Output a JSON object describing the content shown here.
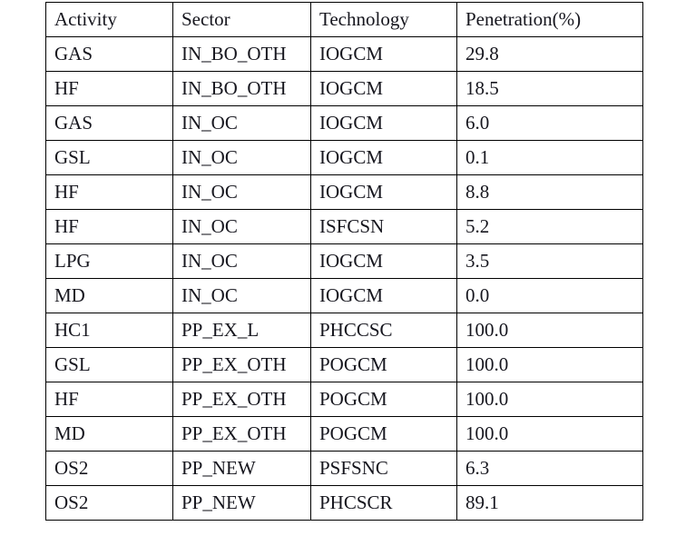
{
  "table": {
    "columns": [
      "Activity",
      "Sector",
      "Technology",
      "Penetration(%)"
    ],
    "rows": [
      {
        "activity": "GAS",
        "sector": "IN_BO_OTH",
        "technology": "IOGCM",
        "penetration": "29.8"
      },
      {
        "activity": "HF",
        "sector": "IN_BO_OTH",
        "technology": "IOGCM",
        "penetration": "18.5"
      },
      {
        "activity": "GAS",
        "sector": "IN_OC",
        "technology": "IOGCM",
        "penetration": "6.0"
      },
      {
        "activity": "GSL",
        "sector": "IN_OC",
        "technology": "IOGCM",
        "penetration": "0.1"
      },
      {
        "activity": "HF",
        "sector": "IN_OC",
        "technology": "IOGCM",
        "penetration": "8.8"
      },
      {
        "activity": "HF",
        "sector": "IN_OC",
        "technology": "ISFCSN",
        "penetration": "5.2"
      },
      {
        "activity": "LPG",
        "sector": "IN_OC",
        "technology": "IOGCM",
        "penetration": "3.5"
      },
      {
        "activity": "MD",
        "sector": "IN_OC",
        "technology": "IOGCM",
        "penetration": "0.0"
      },
      {
        "activity": "HC1",
        "sector": "PP_EX_L",
        "technology": "PHCCSC",
        "penetration": "100.0"
      },
      {
        "activity": "GSL",
        "sector": "PP_EX_OTH",
        "technology": "POGCM",
        "penetration": "100.0"
      },
      {
        "activity": "HF",
        "sector": "PP_EX_OTH",
        "technology": "POGCM",
        "penetration": "100.0"
      },
      {
        "activity": "MD",
        "sector": "PP_EX_OTH",
        "technology": "POGCM",
        "penetration": "100.0"
      },
      {
        "activity": "OS2",
        "sector": "PP_NEW",
        "technology": "PSFSNC",
        "penetration": "6.3"
      },
      {
        "activity": "OS2",
        "sector": "PP_NEW",
        "technology": "PHCSCR",
        "penetration": "89.1"
      }
    ]
  },
  "colors": {
    "text": "#16161e",
    "border": "#000000",
    "background": "#ffffff"
  }
}
